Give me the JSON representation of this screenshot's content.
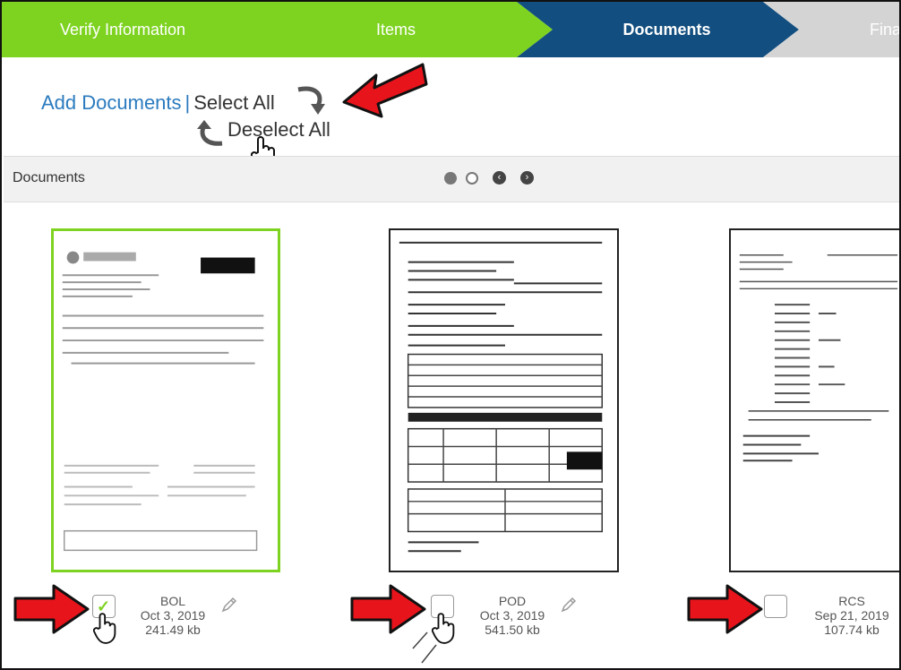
{
  "stepper": {
    "steps": [
      {
        "label": "Verify Information",
        "state": "complete"
      },
      {
        "label": "Items",
        "state": "complete"
      },
      {
        "label": "Documents",
        "state": "active"
      },
      {
        "label": "Final",
        "state": "pending"
      }
    ]
  },
  "actions": {
    "add_documents": "Add Documents",
    "separator": "|",
    "select_all": "Select All",
    "deselect_all": "Deselect All"
  },
  "docbar": {
    "title": "Documents",
    "pages": 2,
    "current_page": 1,
    "prev_icon": "chevron-left-icon",
    "next_icon": "chevron-right-icon"
  },
  "documents": [
    {
      "name": "BOL",
      "date": "Oct 3, 2019",
      "size": "241.49 kb",
      "selected": true,
      "editable": true
    },
    {
      "name": "POD",
      "date": "Oct 3, 2019",
      "size": "541.50 kb",
      "selected": false,
      "editable": true
    },
    {
      "name": "RCS",
      "date": "Sep 21, 2019",
      "size": "107.74 kb",
      "selected": false,
      "editable": false
    }
  ],
  "colors": {
    "step_complete": "#7ed321",
    "step_active": "#124e7f",
    "step_pending": "#d4d4d4",
    "link": "#2b7bbf",
    "annotation_arrow": "#e8141b"
  }
}
